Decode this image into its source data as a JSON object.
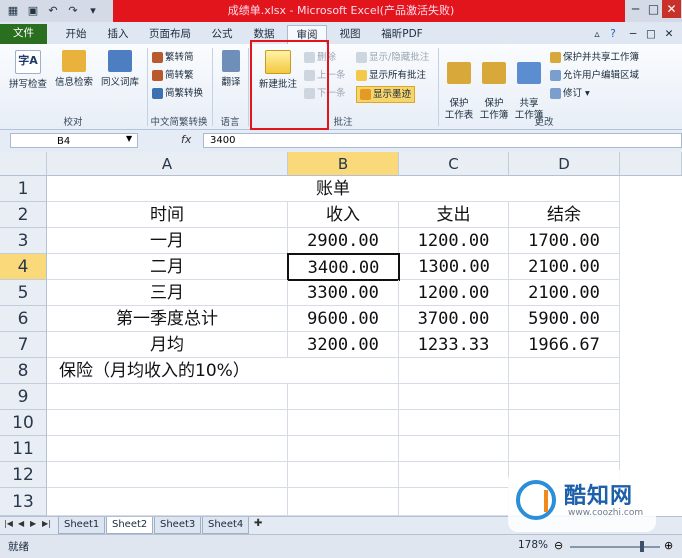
{
  "window": {
    "title": "成绩单.xlsx - Microsoft Excel(产品激活失败)"
  },
  "tabs": [
    {
      "id": "file",
      "label": "文件"
    },
    {
      "id": "home",
      "label": "开始"
    },
    {
      "id": "insert",
      "label": "插入"
    },
    {
      "id": "layout",
      "label": "页面布局"
    },
    {
      "id": "formula",
      "label": "公式"
    },
    {
      "id": "data",
      "label": "数据"
    },
    {
      "id": "review",
      "label": "审阅"
    },
    {
      "id": "view",
      "label": "视图"
    },
    {
      "id": "pdf",
      "label": "福昕PDF"
    }
  ],
  "ribbon": {
    "proofing": {
      "spell": "拼写检查",
      "research": "信息检索",
      "thesaurus": "同义词库",
      "label": "校对"
    },
    "chinese": {
      "to_simplified": "繁转简",
      "to_traditional": "简转繁",
      "convert": "简繁转换",
      "label": "中文简繁转换"
    },
    "language": {
      "translate": "翻译",
      "label": "语言"
    },
    "comments": {
      "new_comment": "新建批注",
      "delete": "删除",
      "previous": "上一条",
      "next": "下一条",
      "show_hide": "显示/隐藏批注",
      "show_all": "显示所有批注",
      "show_ink": "显示墨迹",
      "label": "批注"
    },
    "changes": {
      "protect_sheet": "保护\n工作表",
      "protect_book": "保护\n工作簿",
      "share_book": "共享\n工作簿",
      "protect_share": "保护并共享工作簿",
      "allow_edit": "允许用户编辑区域",
      "track": "修订",
      "label": "更改"
    }
  },
  "formula_bar": {
    "name_box": "B4",
    "fx": "fx",
    "value": "3400"
  },
  "columns": [
    "A",
    "B",
    "C",
    "D"
  ],
  "rows": [
    "1",
    "2",
    "3",
    "4",
    "5",
    "6",
    "7",
    "8",
    "9",
    "10",
    "11",
    "12",
    "13"
  ],
  "cells": {
    "title": "账单",
    "headers": [
      "时间",
      "收入",
      "支出",
      "结余"
    ],
    "data": [
      [
        "一月",
        "2900.00",
        "1200.00",
        "1700.00"
      ],
      [
        "二月",
        "3400.00",
        "1300.00",
        "2100.00"
      ],
      [
        "三月",
        "3300.00",
        "1200.00",
        "2100.00"
      ],
      [
        "第一季度总计",
        "9600.00",
        "3700.00",
        "5900.00"
      ],
      [
        "月均",
        "3200.00",
        "1233.33",
        "1966.67"
      ]
    ],
    "insurance": "保险（月均收入的10%）"
  },
  "sheets": [
    "Sheet1",
    "Sheet2",
    "Sheet3",
    "Sheet4"
  ],
  "status": {
    "mode": "就绪",
    "zoom": "178%"
  },
  "watermark": {
    "name": "酷知网",
    "url": "www.coozhi.com"
  },
  "colors": {
    "title_bar": "#e2141c",
    "file_tab": "#2a6e1f",
    "selected_header": "#f9d97a",
    "highlight_box": "#e2141c"
  }
}
